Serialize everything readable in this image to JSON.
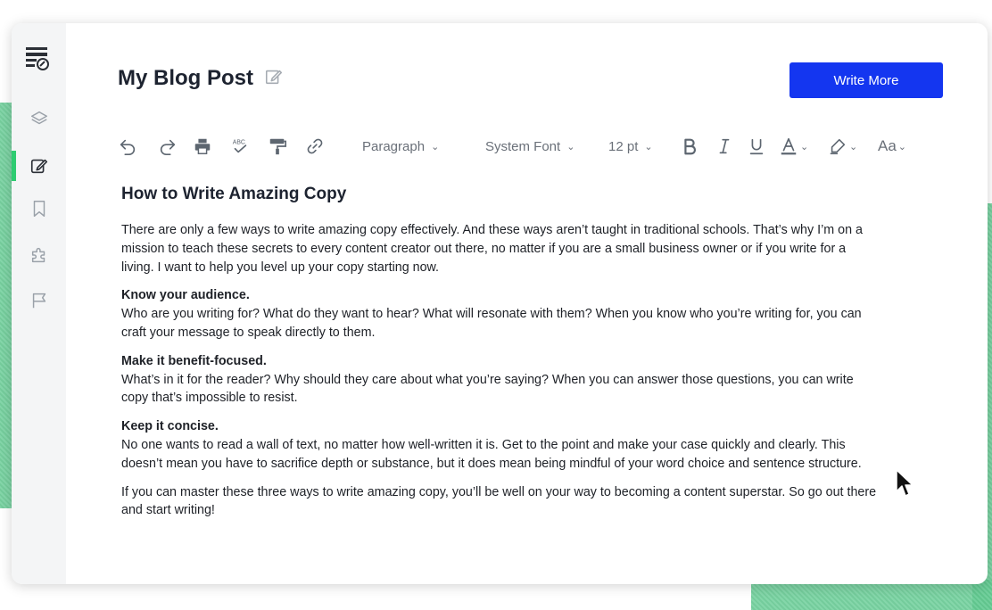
{
  "window": {
    "title": "My Blog Post",
    "primary_button": "Write More"
  },
  "sidebar": {
    "items": [
      {
        "name": "layers"
      },
      {
        "name": "edit",
        "active": true
      },
      {
        "name": "bookmark"
      },
      {
        "name": "puzzle"
      },
      {
        "name": "flag"
      }
    ]
  },
  "toolbar": {
    "block_style": "Paragraph",
    "font": "System Font",
    "font_size": "12 pt"
  },
  "document": {
    "heading": "How to Write Amazing Copy",
    "intro": "There are only a few ways to write amazing copy effectively. And these ways aren’t taught in traditional schools. That’s why I’m on a mission to teach these secrets to every content creator out there, no matter if you are a small business owner or if you write for a living. I want to help you level up your copy starting now.",
    "sections": [
      {
        "title": "Know your audience.",
        "text": "Who are you writing for? What do they want to hear? What will resonate with them? When you know who you’re writing for, you can craft your message to speak directly to them."
      },
      {
        "title": "Make it benefit-focused.",
        "text": "What’s in it for the reader? Why should they care about what you’re saying? When you can answer those questions, you can write copy that’s impossible to resist."
      },
      {
        "title": "Keep it concise.",
        "text": "No one wants to read a wall of text, no matter how well-written it is. Get to the point and make your case quickly and clearly. This doesn’t mean you have to sacrifice depth or substance, but it does mean being mindful of your word choice and sentence structure."
      }
    ],
    "closing": "If you can master these three ways to write amazing copy, you’ll be well on your way to becoming a content superstar. So go out there and start writing!"
  },
  "colors": {
    "accent": "#1436f0",
    "active_indicator": "#2ecc71",
    "background_pattern": "#6fcf9b"
  }
}
